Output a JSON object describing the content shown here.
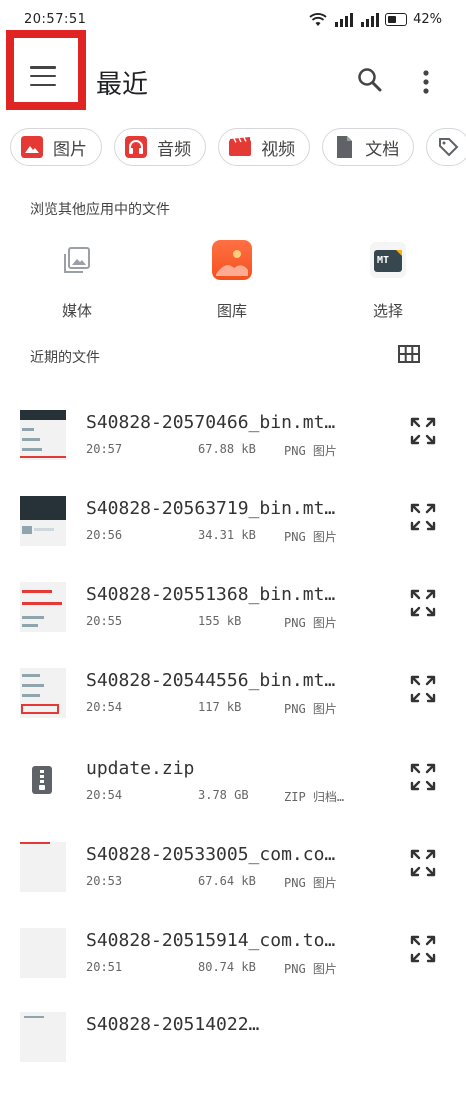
{
  "status_bar": {
    "time": "20:57:51",
    "signal1_label": "5G",
    "signal2_label": "5G",
    "battery": "42%"
  },
  "toolbar": {
    "title": "最近",
    "menu_icon": "hamburger-icon",
    "search_icon": "search-icon",
    "more_icon": "more-vert-icon"
  },
  "chips": [
    {
      "label": "图片",
      "icon": "image-icon",
      "color": "#e53935"
    },
    {
      "label": "音频",
      "icon": "headphones-icon",
      "color": "#e53935"
    },
    {
      "label": "视频",
      "icon": "movie-icon",
      "color": "#e53935"
    },
    {
      "label": "文档",
      "icon": "document-icon",
      "color": "#5f6368"
    }
  ],
  "browse_section": {
    "label": "浏览其他应用中的文件",
    "apps": [
      {
        "label": "媒体",
        "icon": "media-icon"
      },
      {
        "label": "图库",
        "icon": "gallery-icon",
        "color": "#f4511e"
      },
      {
        "label": "选择",
        "icon": "mt-icon",
        "badge": "MT"
      }
    ]
  },
  "recent_section": {
    "label": "近期的文件",
    "view_icon": "grid-view-icon"
  },
  "files": [
    {
      "name": "S40828-20570466_bin.mt…",
      "time": "20:57",
      "size": "67.88 kB",
      "type": "PNG 图片"
    },
    {
      "name": "S40828-20563719_bin.mt…",
      "time": "20:56",
      "size": "34.31 kB",
      "type": "PNG 图片"
    },
    {
      "name": "S40828-20551368_bin.mt…",
      "time": "20:55",
      "size": "155 kB",
      "type": "PNG 图片"
    },
    {
      "name": "S40828-20544556_bin.mt…",
      "time": "20:54",
      "size": "117 kB",
      "type": "PNG 图片"
    },
    {
      "name": "update.zip",
      "time": "20:54",
      "size": "3.78 GB",
      "type": "ZIP 归档…"
    },
    {
      "name": "S40828-20533005_com.co…",
      "time": "20:53",
      "size": "67.64 kB",
      "type": "PNG 图片"
    },
    {
      "name": "S40828-20515914_com.to…",
      "time": "20:51",
      "size": "80.74 kB",
      "type": "PNG 图片"
    },
    {
      "name": "S40828-20514022…",
      "time": "",
      "size": "",
      "type": ""
    }
  ]
}
